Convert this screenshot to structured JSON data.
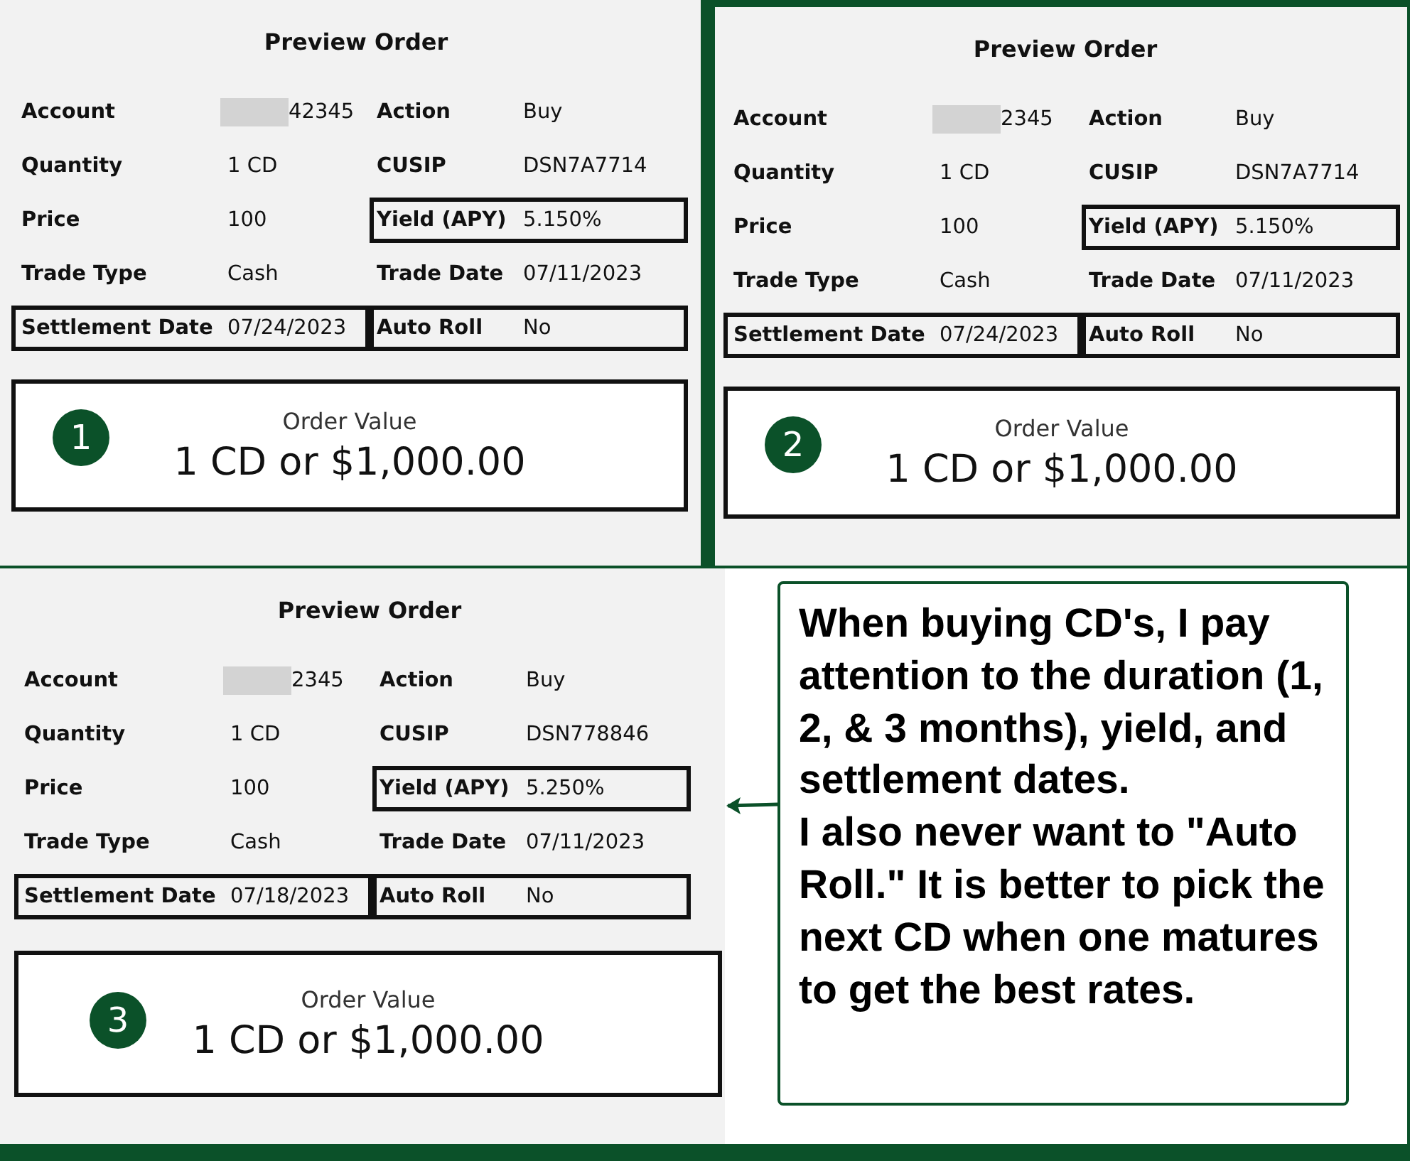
{
  "panels": [
    {
      "title": "Preview Order",
      "badge": "1",
      "fields": [
        {
          "label": "Account",
          "value": "42345",
          "redacted": true,
          "highlighted": false
        },
        {
          "label": "Action",
          "value": "Buy",
          "redacted": false,
          "highlighted": false
        },
        {
          "label": "Quantity",
          "value": "1 CD",
          "redacted": false,
          "highlighted": false
        },
        {
          "label": "CUSIP",
          "value": "DSN7A7714",
          "redacted": false,
          "highlighted": false
        },
        {
          "label": "Price",
          "value": "100",
          "redacted": false,
          "highlighted": false
        },
        {
          "label": "Yield (APY)",
          "value": "5.150%",
          "redacted": false,
          "highlighted": true
        },
        {
          "label": "Trade Type",
          "value": "Cash",
          "redacted": false,
          "highlighted": false
        },
        {
          "label": "Trade Date",
          "value": "07/11/2023",
          "redacted": false,
          "highlighted": false
        },
        {
          "label": "Settlement Date",
          "value": "07/24/2023",
          "redacted": false,
          "highlighted": true
        },
        {
          "label": "Auto Roll",
          "value": "No",
          "redacted": false,
          "highlighted": true
        }
      ],
      "order_value": {
        "label": "Order Value",
        "value": "1 CD or $1,000.00"
      }
    },
    {
      "title": "Preview Order",
      "badge": "2",
      "fields": [
        {
          "label": "Account",
          "value": "2345",
          "redacted": true,
          "highlighted": false
        },
        {
          "label": "Action",
          "value": "Buy",
          "redacted": false,
          "highlighted": false
        },
        {
          "label": "Quantity",
          "value": "1 CD",
          "redacted": false,
          "highlighted": false
        },
        {
          "label": "CUSIP",
          "value": "DSN7A7714",
          "redacted": false,
          "highlighted": false
        },
        {
          "label": "Price",
          "value": "100",
          "redacted": false,
          "highlighted": false
        },
        {
          "label": "Yield (APY)",
          "value": "5.150%",
          "redacted": false,
          "highlighted": true
        },
        {
          "label": "Trade Type",
          "value": "Cash",
          "redacted": false,
          "highlighted": false
        },
        {
          "label": "Trade Date",
          "value": "07/11/2023",
          "redacted": false,
          "highlighted": false
        },
        {
          "label": "Settlement Date",
          "value": "07/24/2023",
          "redacted": false,
          "highlighted": true
        },
        {
          "label": "Auto Roll",
          "value": "No",
          "redacted": false,
          "highlighted": true
        }
      ],
      "order_value": {
        "label": "Order Value",
        "value": "1 CD or $1,000.00"
      }
    },
    {
      "title": "Preview Order",
      "badge": "3",
      "fields": [
        {
          "label": "Account",
          "value": "2345",
          "redacted": true,
          "highlighted": false
        },
        {
          "label": "Action",
          "value": "Buy",
          "redacted": false,
          "highlighted": false
        },
        {
          "label": "Quantity",
          "value": "1 CD",
          "redacted": false,
          "highlighted": false
        },
        {
          "label": "CUSIP",
          "value": "DSN778846",
          "redacted": false,
          "highlighted": false
        },
        {
          "label": "Price",
          "value": "100",
          "redacted": false,
          "highlighted": false
        },
        {
          "label": "Yield (APY)",
          "value": "5.250%",
          "redacted": false,
          "highlighted": true
        },
        {
          "label": "Trade Type",
          "value": "Cash",
          "redacted": false,
          "highlighted": false
        },
        {
          "label": "Trade Date",
          "value": "07/11/2023",
          "redacted": false,
          "highlighted": false
        },
        {
          "label": "Settlement Date",
          "value": "07/18/2023",
          "redacted": false,
          "highlighted": true
        },
        {
          "label": "Auto Roll",
          "value": "No",
          "redacted": false,
          "highlighted": true
        }
      ],
      "order_value": {
        "label": "Order Value",
        "value": "1 CD or $1,000.00"
      }
    }
  ],
  "note": {
    "text": "When buying CD's, I pay attention to the duration (1, 2, & 3 months), yield, and settlement dates.\nI also never want to \"Auto Roll.\" It is better to pick the next CD when one matures to get the best rates."
  }
}
